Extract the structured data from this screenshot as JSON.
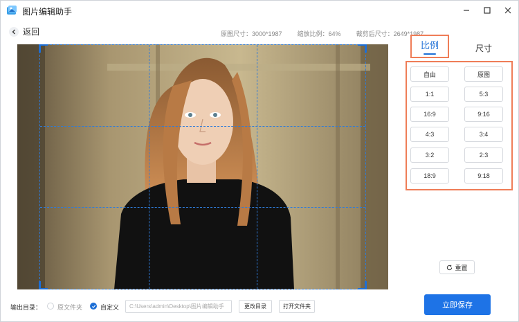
{
  "app": {
    "title": "图片编辑助手",
    "icon": "app-logo-icon"
  },
  "window_controls": {
    "minimize": "minimize-icon",
    "maximize": "maximize-icon",
    "close": "close-icon"
  },
  "header": {
    "back_label": "返回",
    "original_size": "原图尺寸：3000*1987",
    "zoom_ratio": "缩放比例：64%",
    "cropped_size": "裁剪后尺寸：2649*1987"
  },
  "panel": {
    "tabs": [
      {
        "label": "比例",
        "active": true
      },
      {
        "label": "尺寸",
        "active": false
      }
    ],
    "ratios": [
      "自由",
      "原图",
      "1:1",
      "5:3",
      "16:9",
      "9:16",
      "4:3",
      "3:4",
      "3:2",
      "2:3",
      "18:9",
      "9:18"
    ],
    "reset_label": "重置"
  },
  "footer": {
    "output_label": "输出目录：",
    "option_original": "原文件夹",
    "option_custom": "自定义",
    "selected_option": "自定义",
    "path_value": "C:\\Users\\admin\\Desktop\\图片编辑助手",
    "change_dir_label": "更改目录",
    "open_folder_label": "打开文件夹",
    "save_label": "立即保存"
  },
  "colors": {
    "accent": "#1e73e6",
    "highlight": "#ef7d57",
    "crop_line": "#2f7bd8"
  }
}
